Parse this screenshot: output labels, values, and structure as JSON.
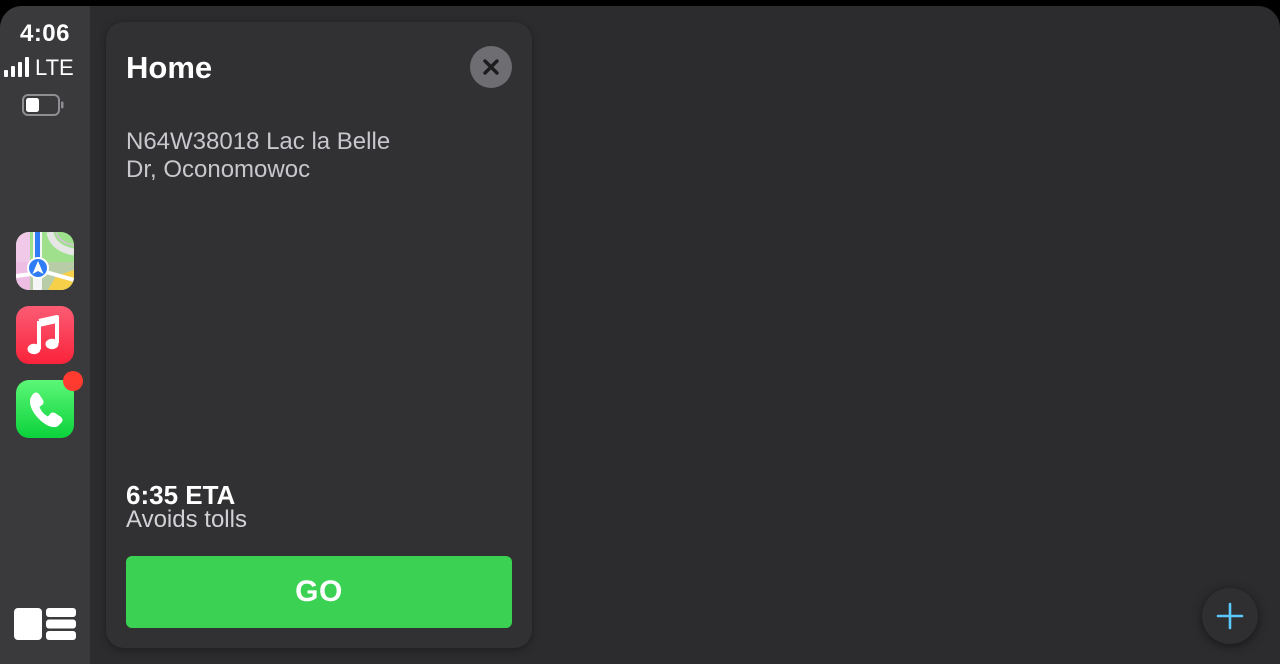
{
  "status_bar": {
    "time": "4:06",
    "network": "LTE"
  },
  "sidebar": {
    "apps": [
      {
        "name": "Maps",
        "icon": "maps-icon"
      },
      {
        "name": "Music",
        "icon": "music-icon"
      },
      {
        "name": "Phone",
        "icon": "phone-icon",
        "has_badge": true
      }
    ],
    "dashboard_icon": "dashboard-icon"
  },
  "card": {
    "title": "Home",
    "address_line1": "N64W38018 Lac la Belle",
    "address_line2": "Dr, Oconomowoc",
    "eta": "6:35 ETA",
    "route_note": "Avoids tolls",
    "go_label": "GO",
    "close_icon": "close-icon"
  },
  "map_controls": {
    "add_icon": "plus-icon"
  },
  "colors": {
    "go_green": "#3bd153",
    "badge_red": "#ff3b30",
    "accent_blue": "#5ac8fa",
    "background": "#2c2c2e",
    "sidebar": "#3a3a3c"
  }
}
